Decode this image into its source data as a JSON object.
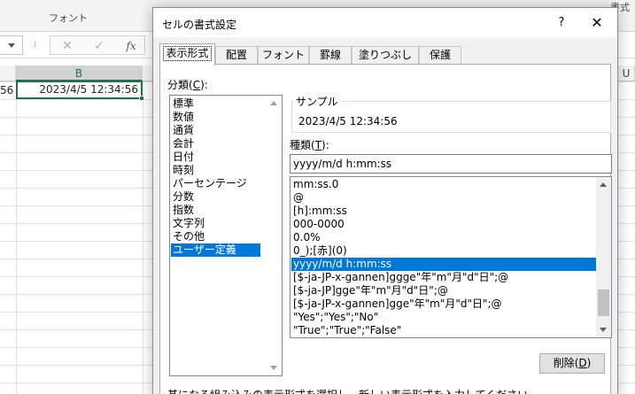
{
  "excel": {
    "ribbon_group": "フォント",
    "ribbon_right": "書式",
    "cancel_glyph": "✕",
    "enter_glyph": "✓",
    "fx_label": "fx",
    "selected_column": "B",
    "right_column": "U",
    "cell_a_partial": "56",
    "cell_b_value": "2023/4/5 12:34:56"
  },
  "dialog": {
    "title": "セルの書式設定",
    "help": "?",
    "close": "✕",
    "tabs": [
      {
        "label": "表示形式",
        "active": true
      },
      {
        "label": "配置"
      },
      {
        "label": "フォント"
      },
      {
        "label": "罫線"
      },
      {
        "label": "塗りつぶし"
      },
      {
        "label": "保護"
      }
    ],
    "category": {
      "label_prefix": "分類(",
      "label_key": "C",
      "label_suffix": "):",
      "items": [
        "標準",
        "数値",
        "通貨",
        "会計",
        "日付",
        "時刻",
        "パーセンテージ",
        "分数",
        "指数",
        "文字列",
        "その他",
        "ユーザー定義"
      ],
      "selected_index": 11
    },
    "sample": {
      "label": "サンプル",
      "value": "2023/4/5 12:34:56"
    },
    "type": {
      "label_prefix": "種類(",
      "label_key": "T",
      "label_suffix": "):",
      "value": "yyyy/m/d h:mm:ss"
    },
    "formats": {
      "items": [
        "mm:ss.0",
        "@",
        "[h]:mm:ss",
        "000-0000",
        "0.0%",
        "0_);[赤](0)",
        "yyyy/m/d h:mm:ss",
        "[$-ja-JP-x-gannen]ggge\"年\"m\"月\"d\"日\";@",
        "[$-ja-JP]gge\"年\"m\"月\"d\"日\";@",
        "[$-ja-JP-x-gannen]gge\"年\"m\"月\"d\"日\";@",
        "\"Yes\";\"Yes\";\"No\"",
        "\"True\";\"True\";\"False\""
      ],
      "selected_index": 6
    },
    "delete_button": {
      "label_prefix": "削除(",
      "label_key": "D",
      "label_suffix": ")"
    },
    "description": "基になる組み込みの表示形式を選択し、新しい表示形式を入力してください。"
  }
}
